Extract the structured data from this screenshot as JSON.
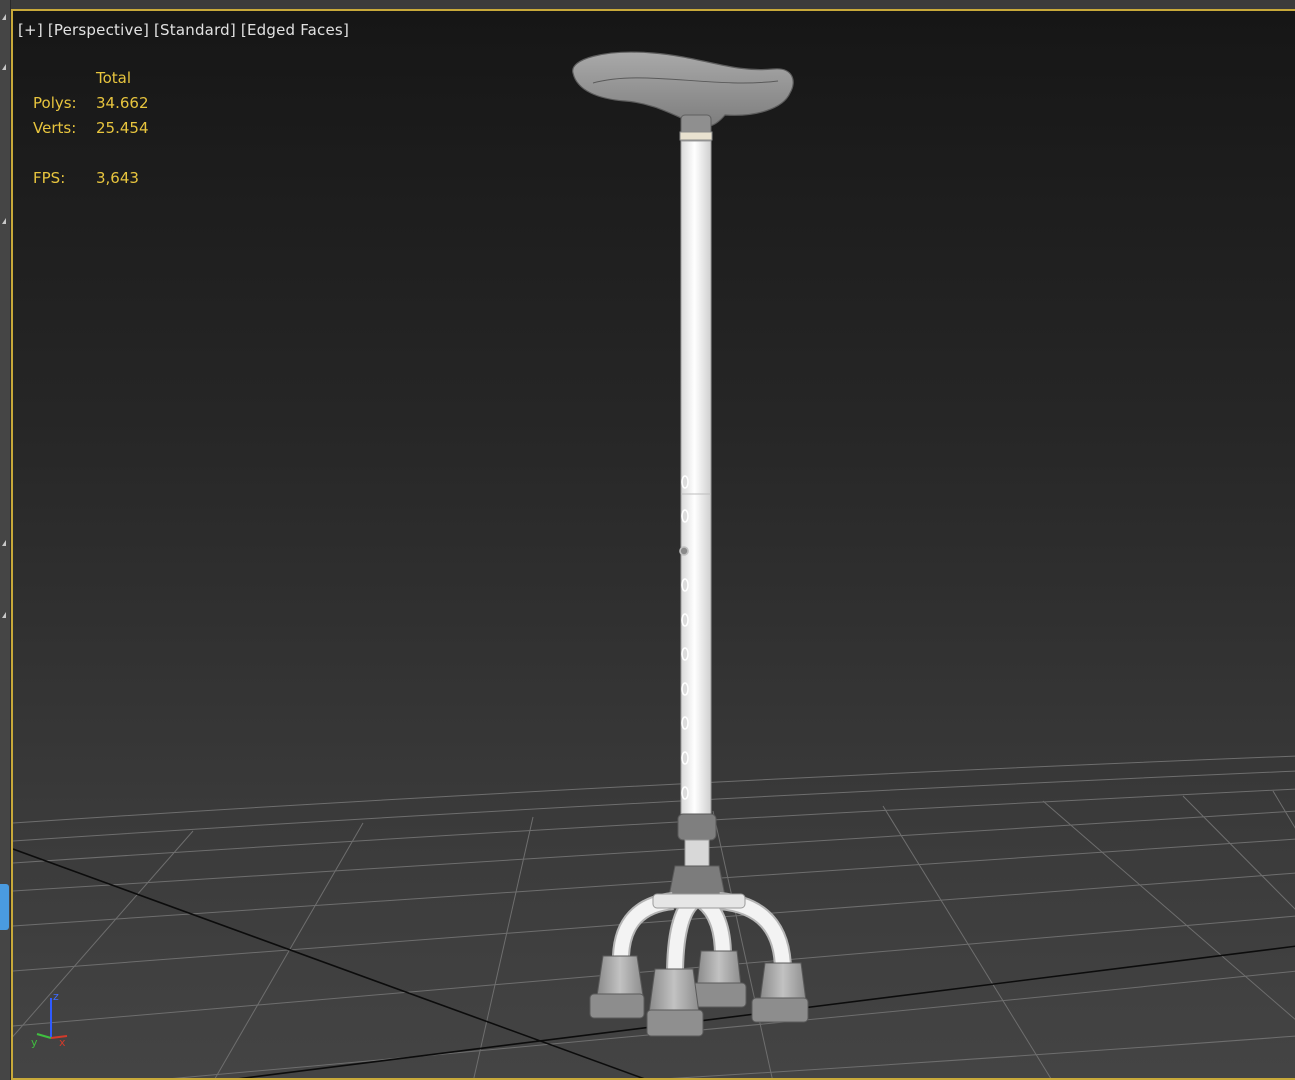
{
  "viewport": {
    "label_plus": "[+]",
    "label_view": "[Perspective]",
    "label_shading": "[Standard]",
    "label_display": "[Edged Faces]"
  },
  "stats": {
    "header": "Total",
    "polys_label": "Polys:",
    "polys_value": "34.662",
    "verts_label": "Verts:",
    "verts_value": "25.454",
    "fps_label": "FPS:",
    "fps_value": "3,643"
  },
  "gizmo": {
    "z_label": "z",
    "x_label": "x",
    "y_label": "y"
  },
  "colors": {
    "active_border": "#c8a93a",
    "stats_text": "#e8c53e",
    "label_text": "#e2e2e2"
  }
}
